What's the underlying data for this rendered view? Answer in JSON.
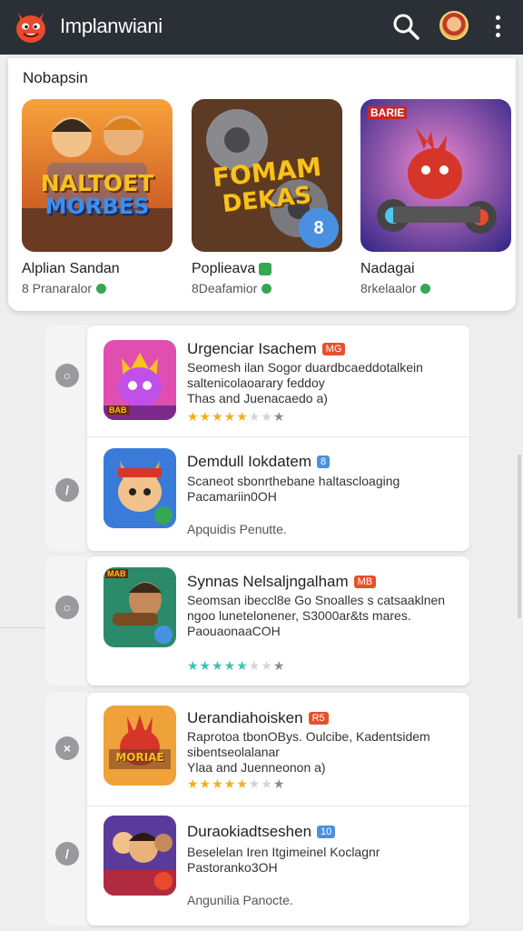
{
  "header": {
    "title": "Implanwiani",
    "logo_icon": "devil-mascot-logo",
    "search_icon": "search-icon",
    "avatar_icon": "user-avatar",
    "menu_icon": "more-vertical-icon"
  },
  "featured": {
    "title": "Nobapsin",
    "items": [
      {
        "name": "Alplian Sandan",
        "sub": "8 Pranaralor",
        "tile_text_1": "NALTOET",
        "tile_text_2": "MORBES"
      },
      {
        "name": "Poplieava",
        "sub": "8Deafamior",
        "tile_text_1": "FOMAM",
        "tile_text_2": "DEKAS",
        "tile_badge": "8"
      },
      {
        "name": "Nadagai",
        "sub": "8rkelaalor",
        "tile_badge": "BARIE"
      }
    ]
  },
  "list": {
    "items": [
      {
        "title": "Urgenciar Isachem",
        "tag": "MG",
        "desc_1": "Seomesh ilan Sogor duardbcaeddotalkein",
        "desc_2": "saltenicolaoarary feddoy",
        "desc_3": "Thas and Juenacaedo a)",
        "rating": 4.5,
        "tile_badge": "BAB"
      },
      {
        "title": "Demdull Iokdatem",
        "tag": "8",
        "desc_1": "Scaneot sbonrthebane haltascloaging",
        "desc_2": "Pacamariin0OH",
        "extra": "Apquidis Penutte."
      },
      {
        "title": "Synnas Nelsaljngalham",
        "tag": "MB",
        "desc_1": "Seomsan ibeccl8e Go Snoalles s catsaaklnen",
        "desc_2": "ngoo lunetelonener, S3000ar&ts mares.",
        "desc_3": "PaouaonaaCOH",
        "rating": 4,
        "tile_badge": "MAB"
      },
      {
        "title": "Uerandiahoisken",
        "tag": "R5",
        "desc_1": "Raprotoa tbonOBys. Oulcibe, Kadentsidem",
        "desc_2": "sibentseolalanar",
        "desc_3": "Ylaa and Juenneonon a)",
        "rating": 4,
        "tile_text": "MORIAE"
      },
      {
        "title": "Duraokiadtseshen",
        "tag": "10",
        "desc_1": "Beselelan Iren Itgimeinel Koclagnr",
        "desc_2": "Pastoranko3OH",
        "extra": "Angunilia Panocte."
      }
    ]
  },
  "colors": {
    "topbar": "#2b2f36",
    "tag_red": "#e8502b",
    "tag_blue": "#4a90e2",
    "star_gold": "#f2b01e",
    "star_teal": "#3ec1b0",
    "verified_green": "#34a853"
  }
}
